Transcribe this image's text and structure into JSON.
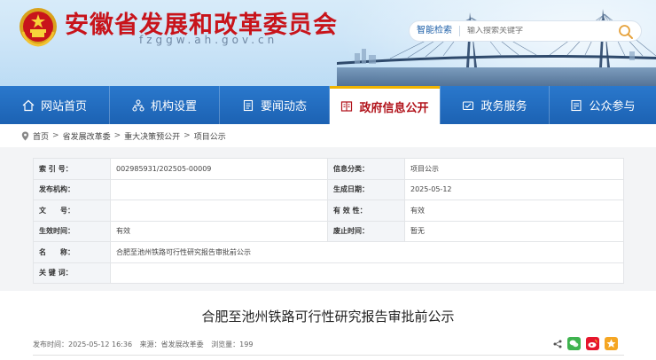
{
  "header": {
    "site_title": "安徽省发展和改革委员会",
    "site_domain": "fzggw.ah.gov.cn",
    "emblem_icon": "national-emblem-icon",
    "search": {
      "label": "智能检索",
      "placeholder": "输入搜索关键字",
      "icon": "search-icon"
    }
  },
  "nav": {
    "items": [
      {
        "label": "网站首页",
        "icon": "home-icon"
      },
      {
        "label": "机构设置",
        "icon": "org-chart-icon"
      },
      {
        "label": "要闻动态",
        "icon": "document-icon"
      },
      {
        "label": "政府信息公开",
        "icon": "info-open-icon",
        "active": true
      },
      {
        "label": "政务服务",
        "icon": "service-icon"
      },
      {
        "label": "公众参与",
        "icon": "participation-icon"
      }
    ],
    "active_color": "#b1121a",
    "bar_color": "#1c62b3"
  },
  "breadcrumb": {
    "items": [
      "首页",
      "省发展改革委",
      "重大决策预公开",
      "项目公示"
    ],
    "separator": ">"
  },
  "info": {
    "index_no_label": "索 引 号：",
    "index_no": "002985931/202505-00009",
    "category_label": "信息分类：",
    "category": "项目公示",
    "publisher_label": "发布机构：",
    "publisher": "",
    "created_label": "生成日期：",
    "created": "2025-05-12",
    "doc_no_label": "文　　号：",
    "doc_no": "",
    "validity_label": "有 效 性：",
    "validity": "有效",
    "effective_label": "生效时间：",
    "effective": "有效",
    "expire_label": "废止时间：",
    "expire": "暂无",
    "name_label": "名　　称：",
    "name": "合肥至池州铁路可行性研究报告审批前公示",
    "keywords_label": "关 键 词：",
    "keywords": ""
  },
  "article": {
    "title": "合肥至池州铁路可行性研究报告审批前公示",
    "publish_time": "发布时间：2025-05-12 16:36",
    "source": "来源：省发展改革委",
    "views": "浏览量：199",
    "share_icons": [
      "share-icon",
      "wechat-icon",
      "weibo-icon",
      "qzone-icon"
    ]
  }
}
